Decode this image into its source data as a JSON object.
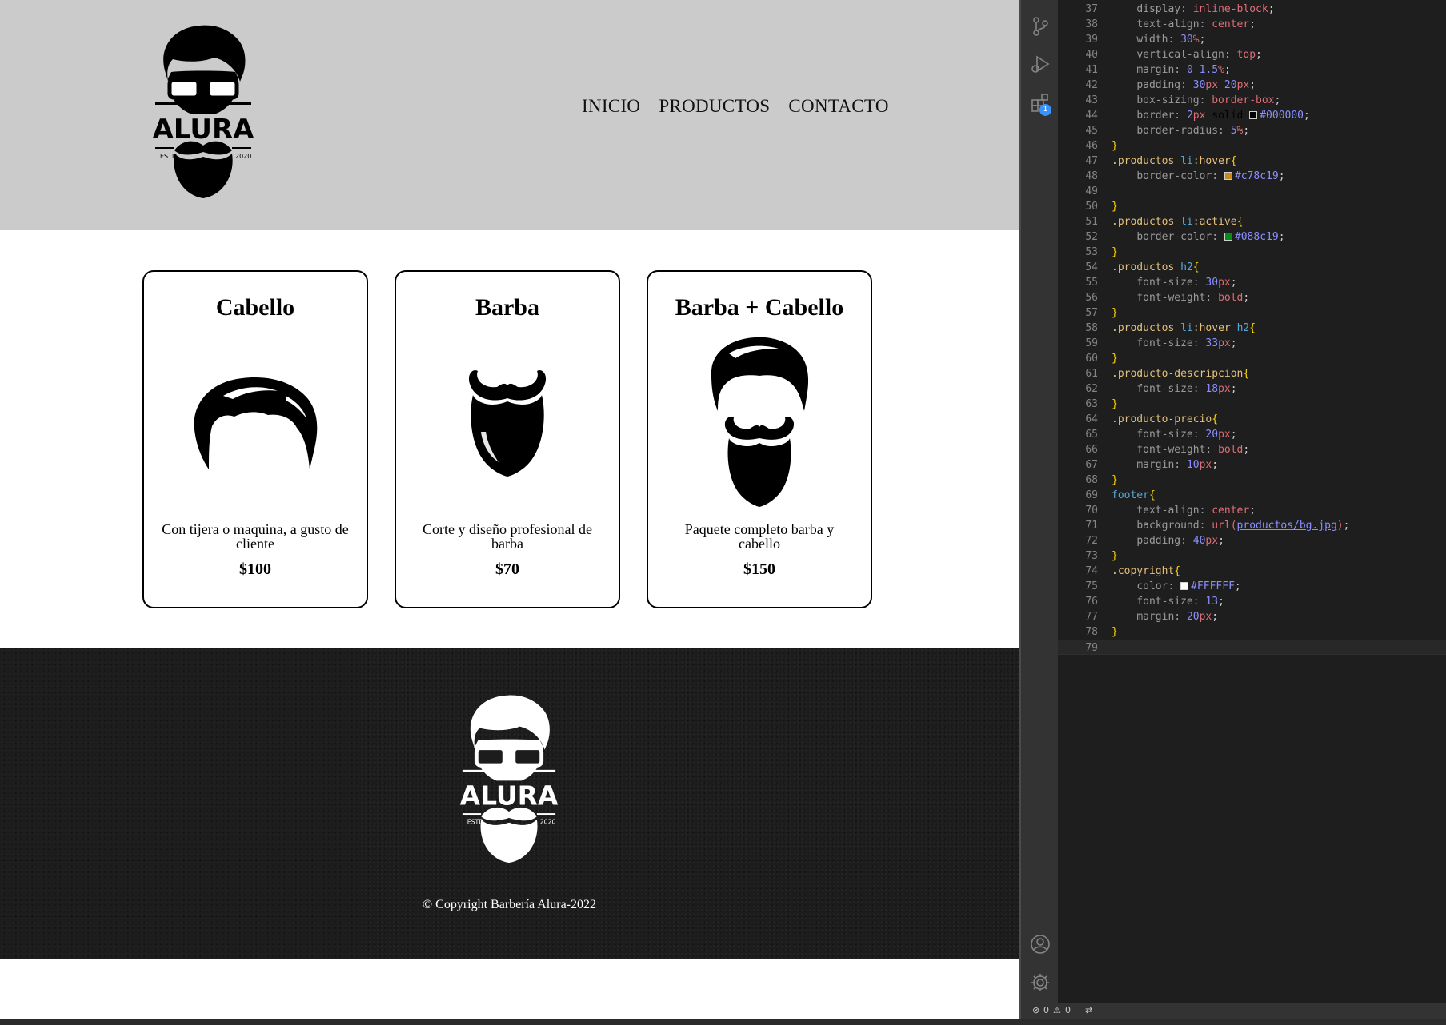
{
  "site": {
    "logo": {
      "name": "ALURA",
      "estd": "ESTD",
      "year": "2020"
    },
    "nav": [
      "INICIO",
      "PRODUCTOS",
      "CONTACTO"
    ],
    "products": [
      {
        "title": "Cabello",
        "description": "Con tijera o maquina, a gusto de cliente",
        "price": "$100",
        "icon": "hair-icon"
      },
      {
        "title": "Barba",
        "description": "Corte y diseño profesional de barba",
        "price": "$70",
        "icon": "beard-icon"
      },
      {
        "title": "Barba + Cabello",
        "description": "Paquete completo barba y cabello",
        "price": "$150",
        "icon": "hair-and-beard-icon"
      }
    ],
    "copyright": "© Copyright Barbería Alura-2022"
  },
  "editor": {
    "activity_icons": [
      "source-control-icon",
      "run-debug-icon",
      "extensions-icon",
      "account-icon",
      "settings-gear-icon"
    ],
    "extensions_badge": "1",
    "status": {
      "errors": "0",
      "warnings": "0"
    },
    "swatch_colors": {
      "black": "#000000",
      "hover": "#c78c19",
      "active": "#088c19",
      "white": "#FFFFFF"
    },
    "lines": [
      {
        "n": "37",
        "text": "    display: inline-block;"
      },
      {
        "n": "38",
        "text": "    text-align: center;"
      },
      {
        "n": "39",
        "text": "    width: 30%;"
      },
      {
        "n": "40",
        "text": "    vertical-align: top;"
      },
      {
        "n": "41",
        "text": "    margin: 0 1.5%;"
      },
      {
        "n": "42",
        "text": "    padding: 30px 20px;"
      },
      {
        "n": "43",
        "text": "    box-sizing: border-box;"
      },
      {
        "n": "44",
        "text": "    border: 2px solid #000000;"
      },
      {
        "n": "45",
        "text": "    border-radius: 5%;"
      },
      {
        "n": "46",
        "text": "}"
      },
      {
        "n": "47",
        "text": ".productos li:hover{"
      },
      {
        "n": "48",
        "text": "    border-color: #c78c19;"
      },
      {
        "n": "49",
        "text": ""
      },
      {
        "n": "50",
        "text": "}"
      },
      {
        "n": "51",
        "text": ".productos li:active{"
      },
      {
        "n": "52",
        "text": "    border-color: #088c19;"
      },
      {
        "n": "53",
        "text": "}"
      },
      {
        "n": "54",
        "text": ".productos h2{"
      },
      {
        "n": "55",
        "text": "    font-size: 30px;"
      },
      {
        "n": "56",
        "text": "    font-weight: bold;"
      },
      {
        "n": "57",
        "text": "}"
      },
      {
        "n": "58",
        "text": ".productos li:hover h2{"
      },
      {
        "n": "59",
        "text": "    font-size: 33px;"
      },
      {
        "n": "60",
        "text": "}"
      },
      {
        "n": "61",
        "text": ".producto-descripcion{"
      },
      {
        "n": "62",
        "text": "    font-size: 18px;"
      },
      {
        "n": "63",
        "text": "}"
      },
      {
        "n": "64",
        "text": ".producto-precio{"
      },
      {
        "n": "65",
        "text": "    font-size: 20px;"
      },
      {
        "n": "66",
        "text": "    font-weight: bold;"
      },
      {
        "n": "67",
        "text": "    margin: 10px;"
      },
      {
        "n": "68",
        "text": "}"
      },
      {
        "n": "69",
        "text": "footer{"
      },
      {
        "n": "70",
        "text": "    text-align: center;"
      },
      {
        "n": "71",
        "text": "    background: url(productos/bg.jpg);"
      },
      {
        "n": "72",
        "text": "    padding: 40px;"
      },
      {
        "n": "73",
        "text": "}"
      },
      {
        "n": "74",
        "text": ".copyright{"
      },
      {
        "n": "75",
        "text": "    color: #FFFFFF;"
      },
      {
        "n": "76",
        "text": "    font-size: 13;"
      },
      {
        "n": "77",
        "text": "    margin: 20px;"
      },
      {
        "n": "78",
        "text": "}"
      },
      {
        "n": "79",
        "text": ""
      }
    ]
  }
}
